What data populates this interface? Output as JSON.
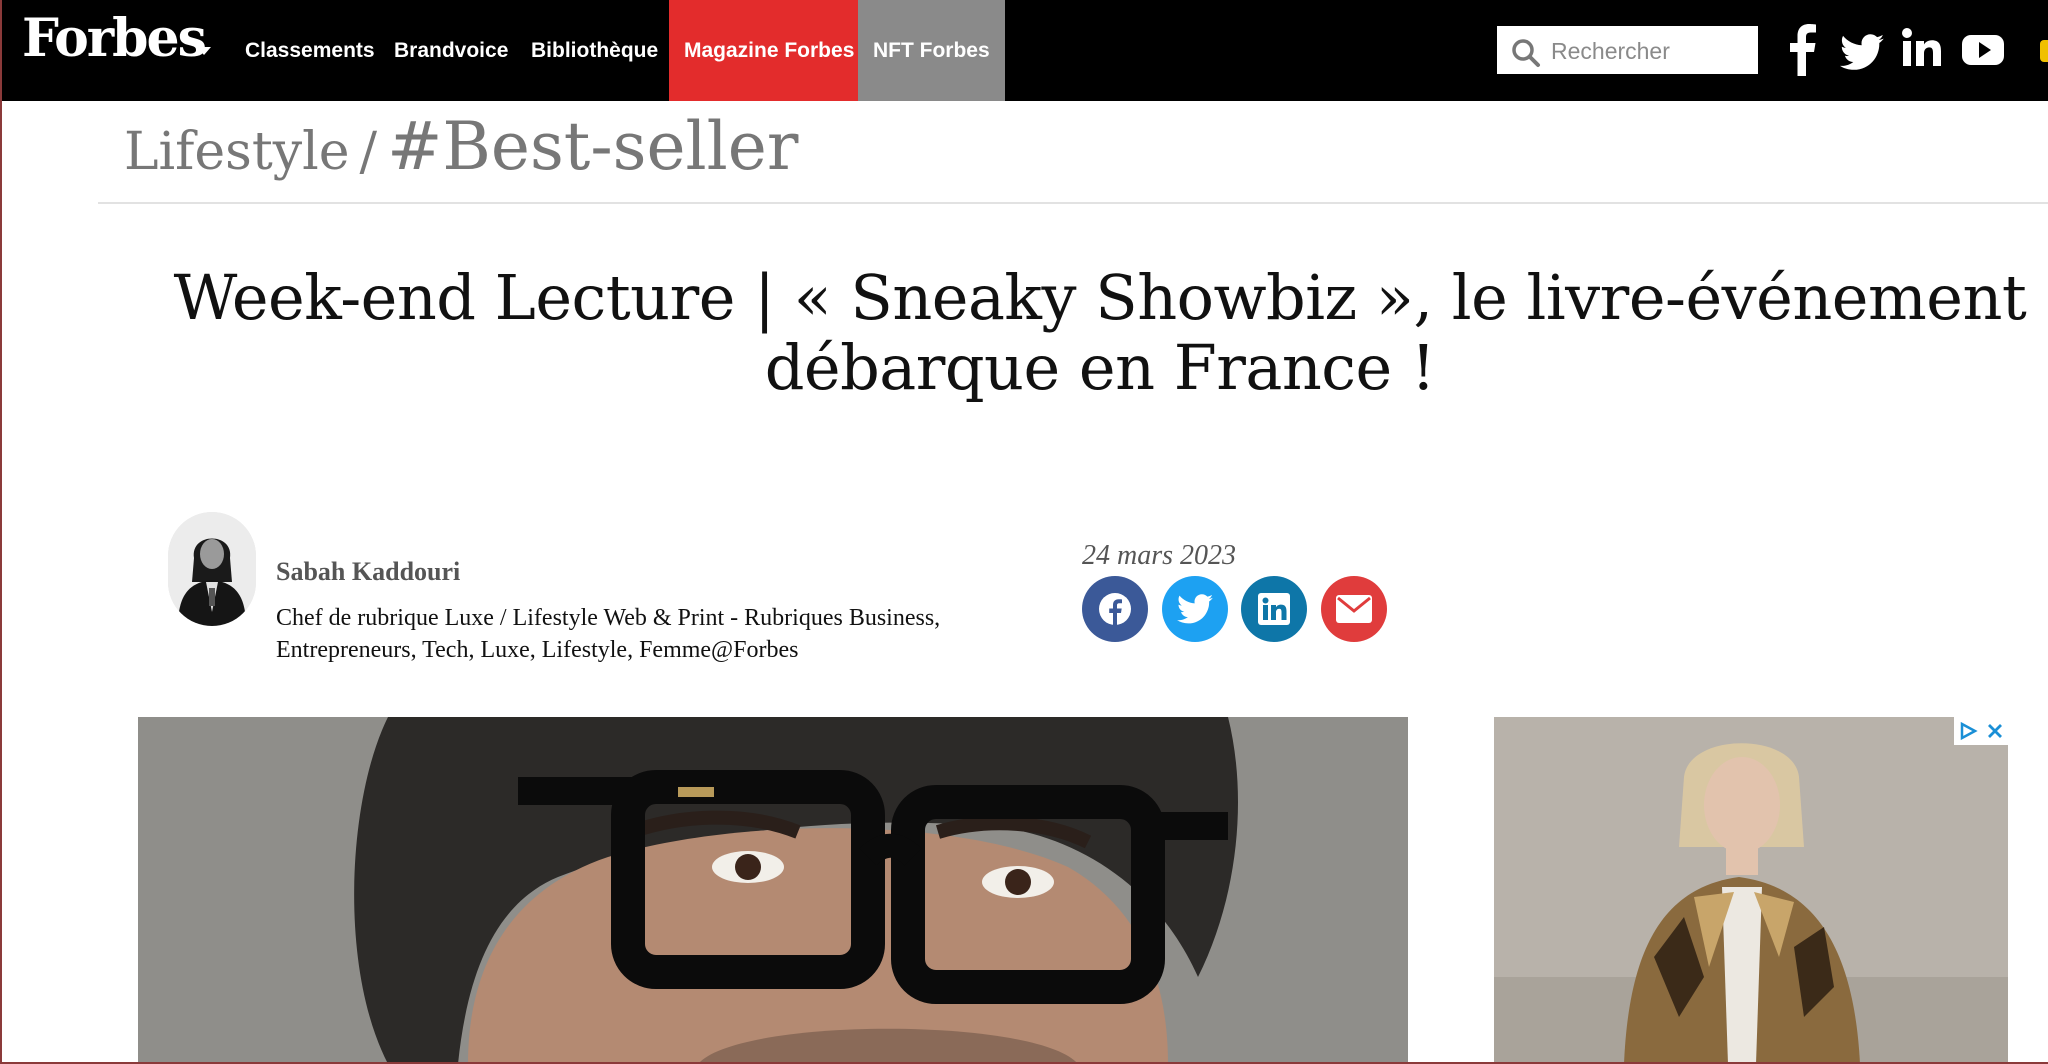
{
  "brand": {
    "logo": "Forbes"
  },
  "nav": {
    "items": [
      {
        "label": "Classements"
      },
      {
        "label": "Brandvoice"
      },
      {
        "label": "Bibliothèque"
      },
      {
        "label": "Magazine Forbes",
        "highlight": "#e32c2c"
      },
      {
        "label": "NFT Forbes",
        "highlight": "#8a8a8a"
      }
    ]
  },
  "search": {
    "placeholder": "Rechercher"
  },
  "social_top": [
    "facebook-icon",
    "twitter-icon",
    "linkedin-icon",
    "youtube-icon"
  ],
  "breadcrumb": {
    "section": "Lifestyle",
    "separator": "/",
    "tag": "#Best-seller"
  },
  "article": {
    "title_line1": "Week-end Lecture | « Sneaky Showbiz », le livre-événement",
    "title_line2": "débarque en France !",
    "author": {
      "name": "Sabah Kaddouri",
      "bio": "Chef de rubrique Luxe / Lifestyle Web & Print - Rubriques Business, Entrepreneurs, Tech, Luxe, Lifestyle, Femme@Forbes"
    },
    "date": "24 mars 2023"
  },
  "share": [
    {
      "icon": "facebook-icon",
      "color": "#3b5998"
    },
    {
      "icon": "twitter-icon",
      "color": "#1da1f2"
    },
    {
      "icon": "linkedin-icon",
      "color": "#0e76a8"
    },
    {
      "icon": "email-icon",
      "color": "#e03c3c"
    }
  ],
  "colors": {
    "nav_bg": "#000000",
    "accent_red": "#e32c2c",
    "nft_gray": "#8a8a8a"
  }
}
